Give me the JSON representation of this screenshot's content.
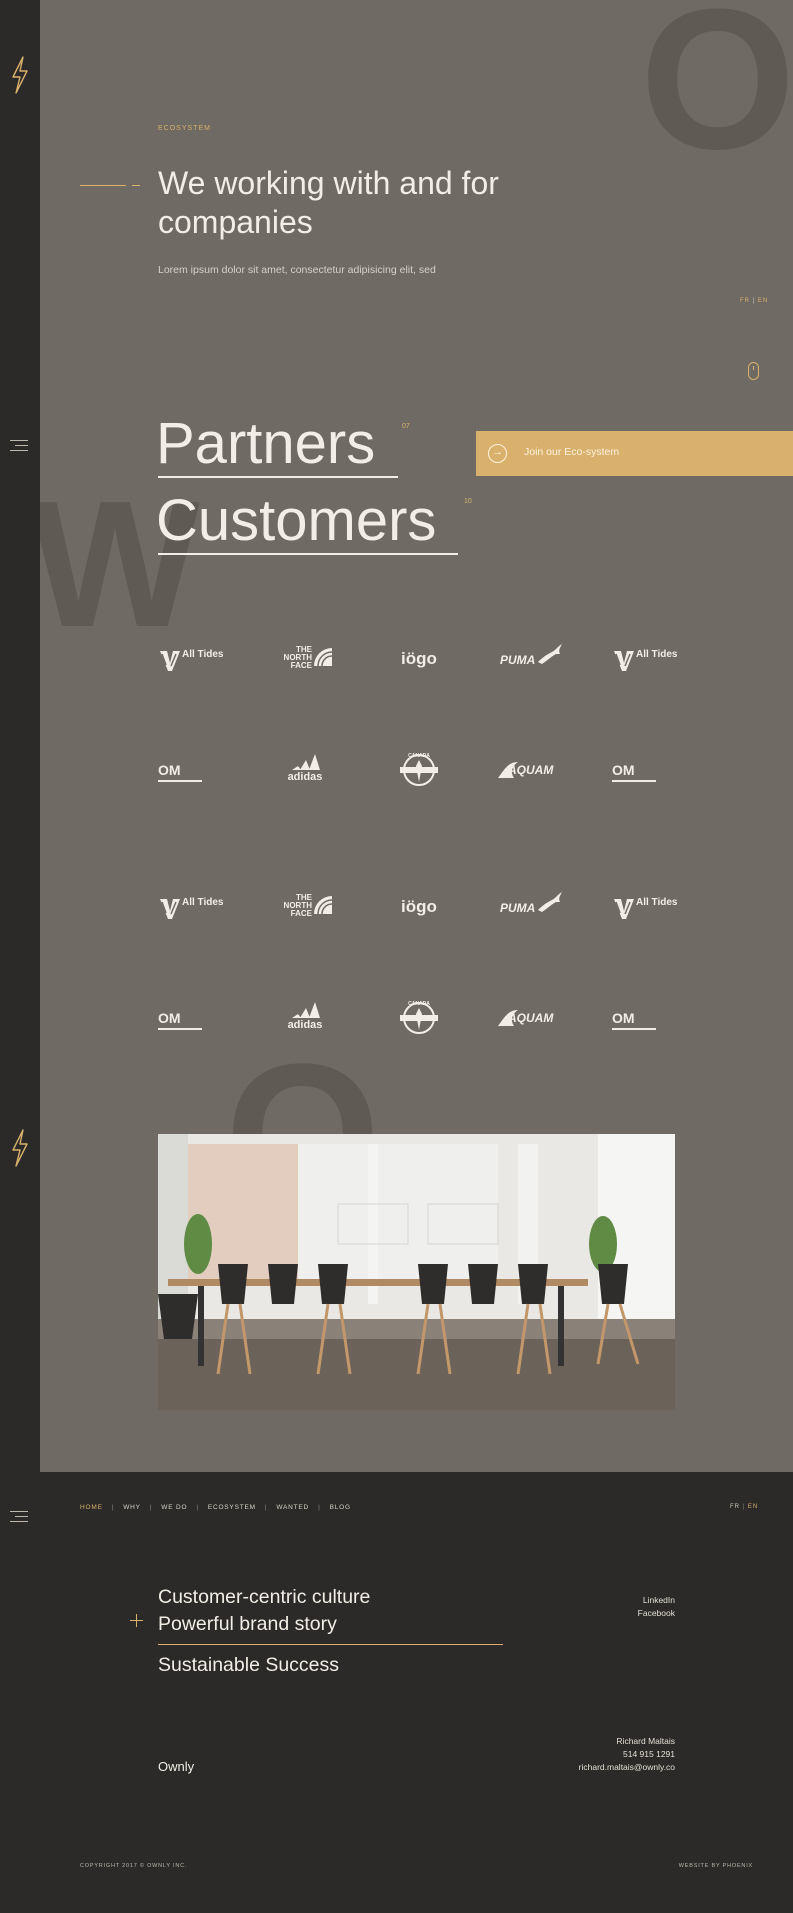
{
  "colors": {
    "accent": "#d9b06c",
    "hero_bg": "#6f6a63",
    "dark_bg": "#2b2a28",
    "text_light": "#f2ede6"
  },
  "rail": {
    "icons": [
      "bolt-icon",
      "menu-icon",
      "bolt-icon",
      "menu-icon"
    ]
  },
  "hero": {
    "eyebrow": "ECOSYSTEM",
    "headline": "We working with and for companies",
    "lead": "Lorem ipsum dolor sit amet, consectetur adipisicing elit, sed",
    "lang": {
      "fr": "FR",
      "sep": "|",
      "en": "EN"
    },
    "background_letters": [
      "O",
      "W",
      "O"
    ]
  },
  "section": {
    "partners": {
      "label": "Partners",
      "count": "07"
    },
    "customers": {
      "label": "Customers",
      "count": "10"
    },
    "cta_label": "Join our Eco-system"
  },
  "logo_rows": [
    [
      "All Tides",
      "THE NORTH FACE",
      "iögo",
      "PUMA",
      "All Tides"
    ],
    [
      "OM",
      "adidas",
      "CANADA",
      "AQUAM",
      "OM"
    ],
    [
      "All Tides",
      "THE NORTH FACE",
      "iögo",
      "PUMA",
      "All Tides"
    ],
    [
      "OM",
      "adidas",
      "CANADA",
      "AQUAM",
      "OM"
    ]
  ],
  "footer": {
    "nav": [
      {
        "label": "HOME",
        "active": true
      },
      {
        "label": "WHY",
        "active": false
      },
      {
        "label": "WE DO",
        "active": false
      },
      {
        "label": "ECOSYSTEM",
        "active": false
      },
      {
        "label": "WANTED",
        "active": false
      },
      {
        "label": "BLOG",
        "active": false
      }
    ],
    "lang": {
      "fr": "FR",
      "sep": "|",
      "en": "EN"
    },
    "culture": [
      "Customer-centric culture",
      "Powerful brand story",
      "Sustainable Success"
    ],
    "social": [
      "LinkedIn",
      "Facebook"
    ],
    "brand": "Ownly",
    "contact": [
      "Richard Maltais",
      "514 915 1291",
      "richard.maltais@ownly.co"
    ],
    "copyright": "COPYRIGHT 2017 © OWNLY INC.",
    "credit": "WEBSITE BY PHOENIX"
  }
}
